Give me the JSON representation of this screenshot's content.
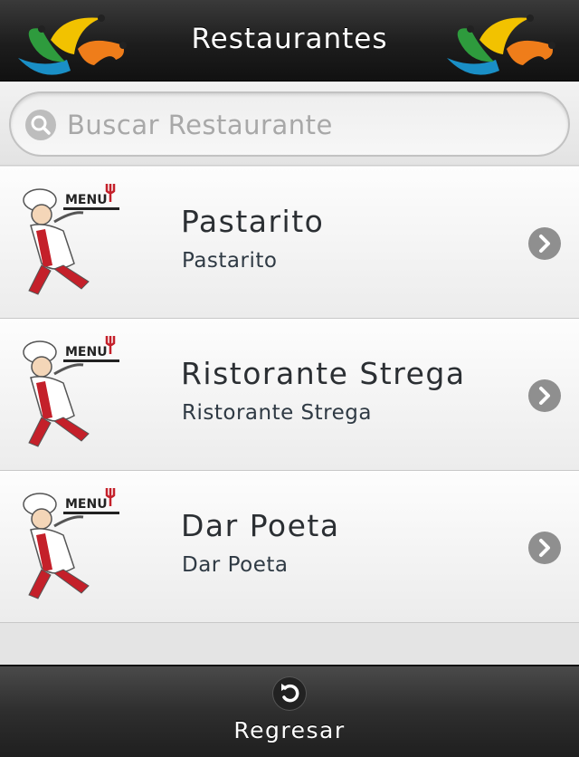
{
  "header": {
    "title": "Restaurantes",
    "logo_icon": "jester-hat-logo-icon"
  },
  "search": {
    "placeholder": "Buscar Restaurante",
    "value": "",
    "icon": "search-icon"
  },
  "restaurants": [
    {
      "name": "Pastarito",
      "subtitle": "Pastarito",
      "thumb_text": "MENU",
      "icon": "chevron-right-icon"
    },
    {
      "name": "Ristorante Strega",
      "subtitle": "Ristorante Strega",
      "thumb_text": "MENU",
      "icon": "chevron-right-icon"
    },
    {
      "name": "Dar Poeta",
      "subtitle": "Dar Poeta",
      "thumb_text": "MENU",
      "icon": "chevron-right-icon"
    }
  ],
  "footer": {
    "back_label": "Regresar",
    "back_icon": "undo-arrow-icon"
  },
  "colors": {
    "header_bg": "#1d1d1d",
    "logo_green": "#2e9b3d",
    "logo_yellow": "#f2c200",
    "logo_orange": "#ef7d1a",
    "logo_blue": "#1a8fc6",
    "accent_red": "#c4202a"
  }
}
